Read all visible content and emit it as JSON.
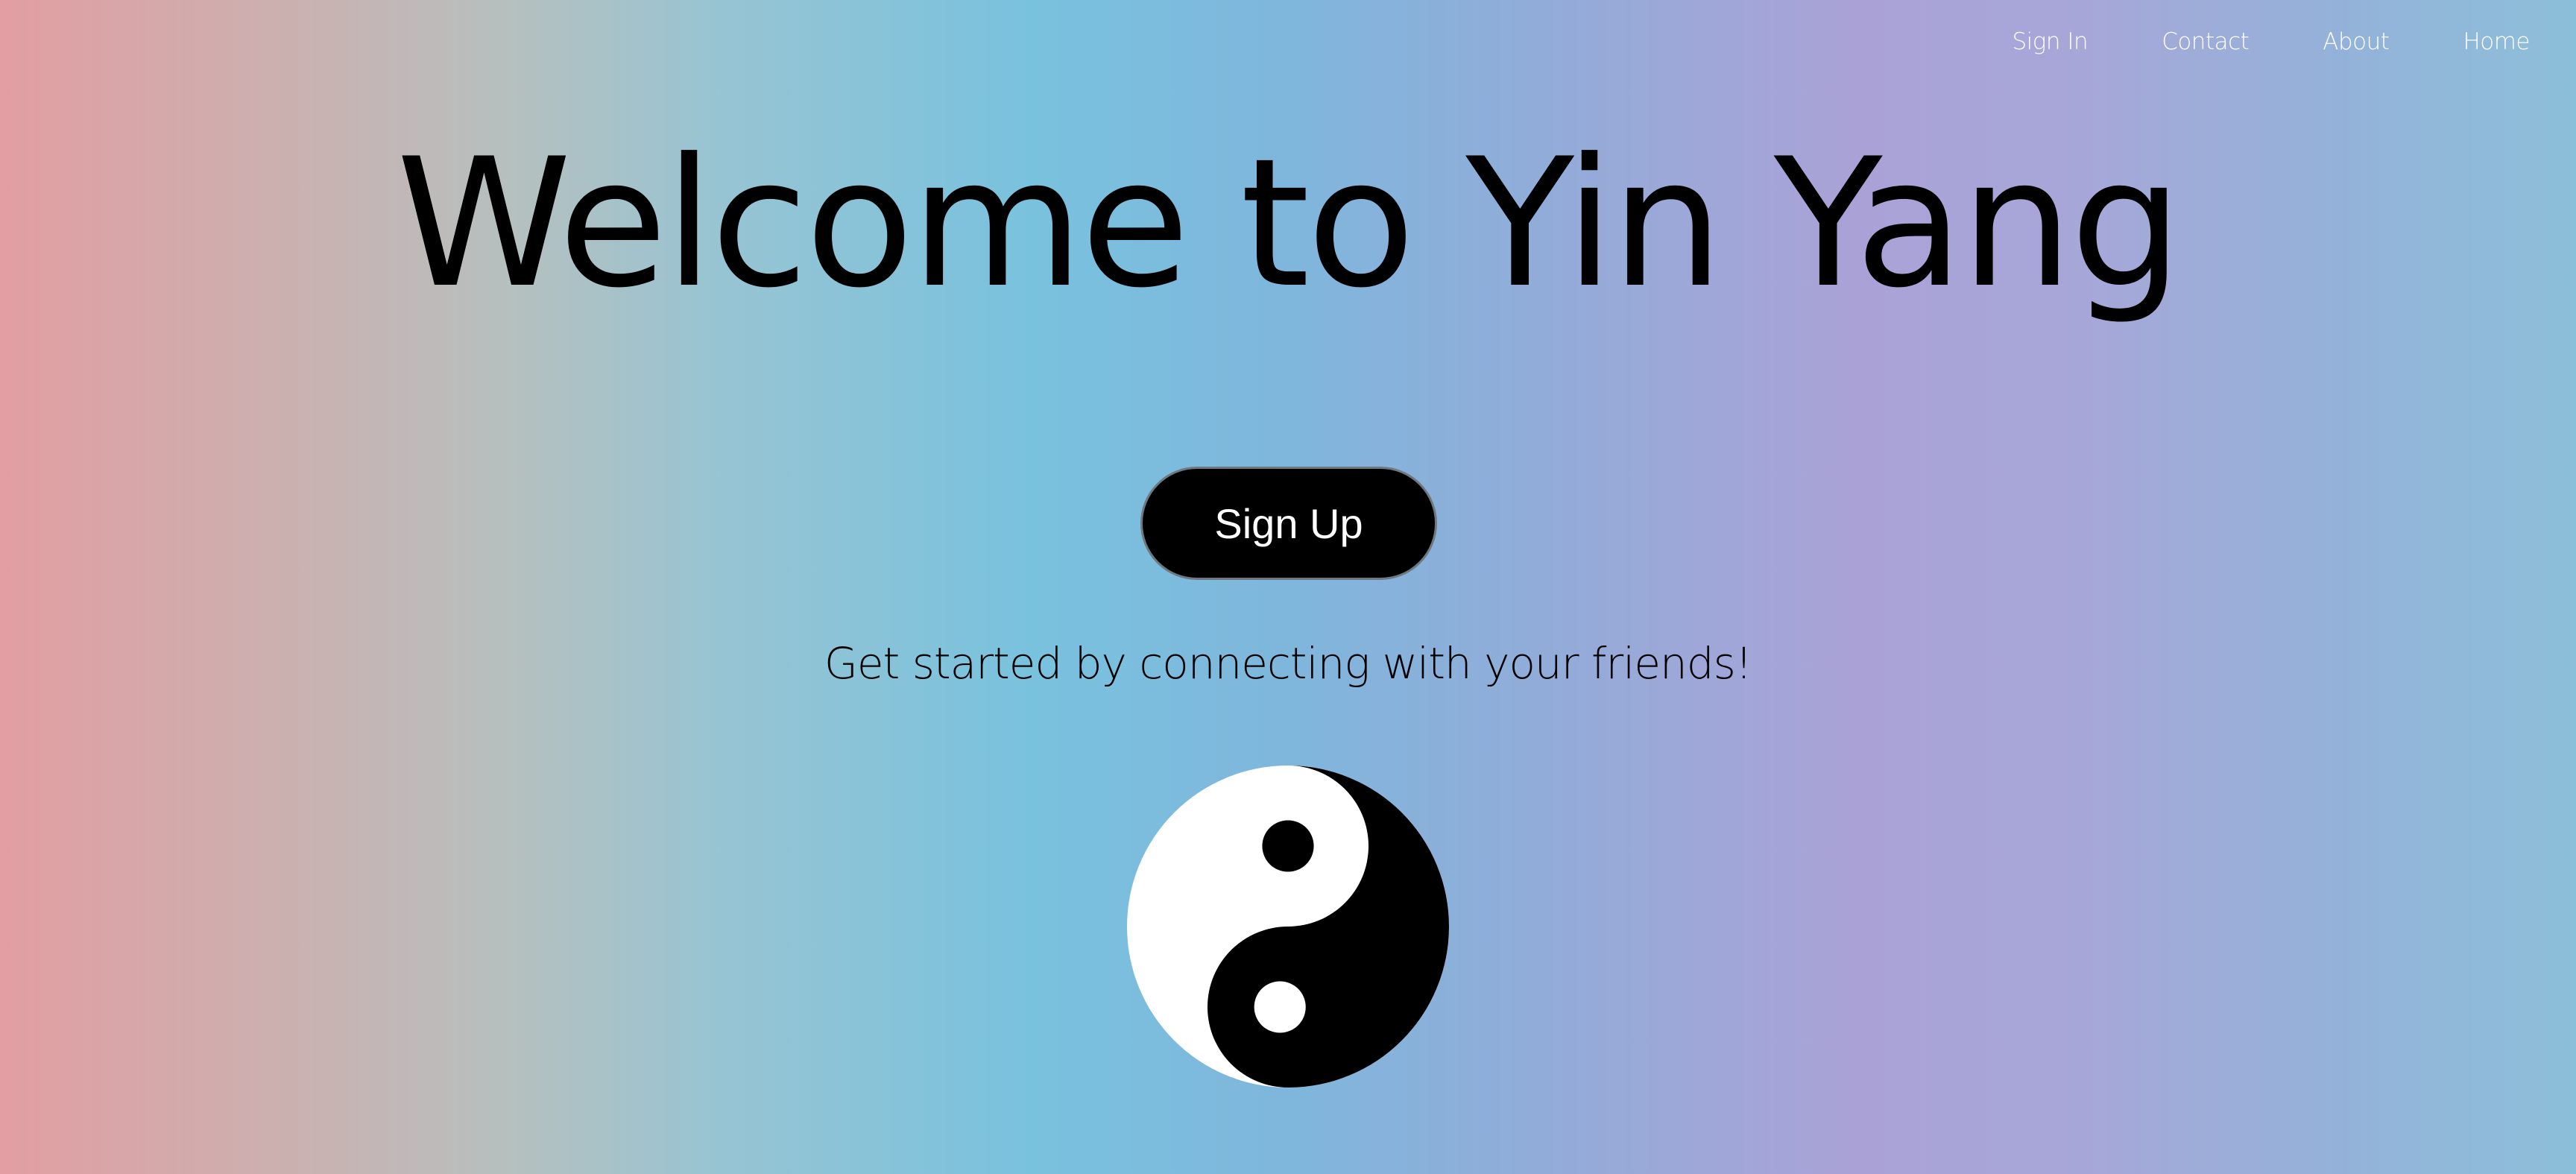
{
  "nav": {
    "items": [
      {
        "label": "Sign In"
      },
      {
        "label": "Contact"
      },
      {
        "label": "About"
      },
      {
        "label": "Home"
      }
    ]
  },
  "hero": {
    "title": "Welcome to Yin Yang",
    "button_label": "Sign Up",
    "tagline": "Get started by connecting with your friends!"
  },
  "logo": {
    "icon": "yin-yang-icon",
    "dark_color": "#000000",
    "light_color": "#ffffff"
  },
  "theme": {
    "gradient_colors": [
      "#e29ea2",
      "#b5c0bf",
      "#79c2de",
      "#aaa2d7",
      "#8cbfd9"
    ],
    "nav_text_color": "#ffffff",
    "button_color": "#000000"
  }
}
